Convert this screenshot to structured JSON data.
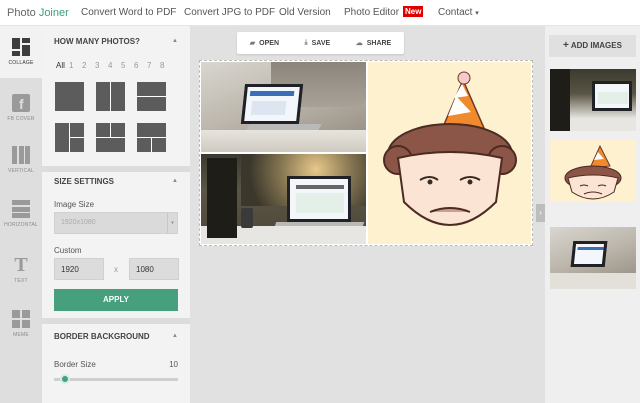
{
  "header": {
    "brand_part1": "Photo ",
    "brand_part2": "Joiner",
    "nav": [
      {
        "label": "Convert Word to PDF"
      },
      {
        "label": "Convert JPG to PDF"
      },
      {
        "label": "Old Version"
      },
      {
        "label": "Photo Editor"
      },
      {
        "label": "Contact"
      }
    ],
    "badge": "New",
    "caret": "▾"
  },
  "rail": {
    "items": [
      {
        "label": "COLLAGE",
        "icon": "collage-icon"
      },
      {
        "label": "FB COVER",
        "icon": "facebook-icon"
      },
      {
        "label": "VERTICAL",
        "icon": "vertical-icon"
      },
      {
        "label": "HORIZONTAL",
        "icon": "horizontal-icon"
      },
      {
        "label": "TEXT",
        "icon": "text-icon",
        "glyph": "T"
      },
      {
        "label": "MEME",
        "icon": "meme-icon"
      }
    ]
  },
  "panel": {
    "how_many": {
      "title": "HOW MANY PHOTOS?",
      "collapse": "▲",
      "options": [
        "All",
        "1",
        "2",
        "3",
        "4",
        "5",
        "6",
        "7",
        "8"
      ],
      "selected": "All"
    },
    "size": {
      "title": "SIZE SETTINGS",
      "collapse": "▲",
      "image_size_label": "Image Size",
      "image_size_value": "1920x1080",
      "select_arrow": "▾",
      "custom_label": "Custom",
      "width": "1920",
      "sep": "x",
      "height": "1080",
      "apply": "APPLY"
    },
    "border": {
      "title": "BORDER BACKGROUND",
      "collapse": "▲",
      "border_size_label": "Border Size",
      "border_size_value": "10"
    }
  },
  "toolbar": {
    "open": "OPEN",
    "save": "SAVE",
    "share": "SHARE",
    "open_icon": "▰",
    "save_icon": "⤓",
    "share_icon": "☁"
  },
  "expand_arrow": "›",
  "images": {
    "add_label": "ADD IMAGES",
    "plus": "+"
  },
  "colors": {
    "accent": "#46a07d",
    "badge": "#e00000"
  }
}
